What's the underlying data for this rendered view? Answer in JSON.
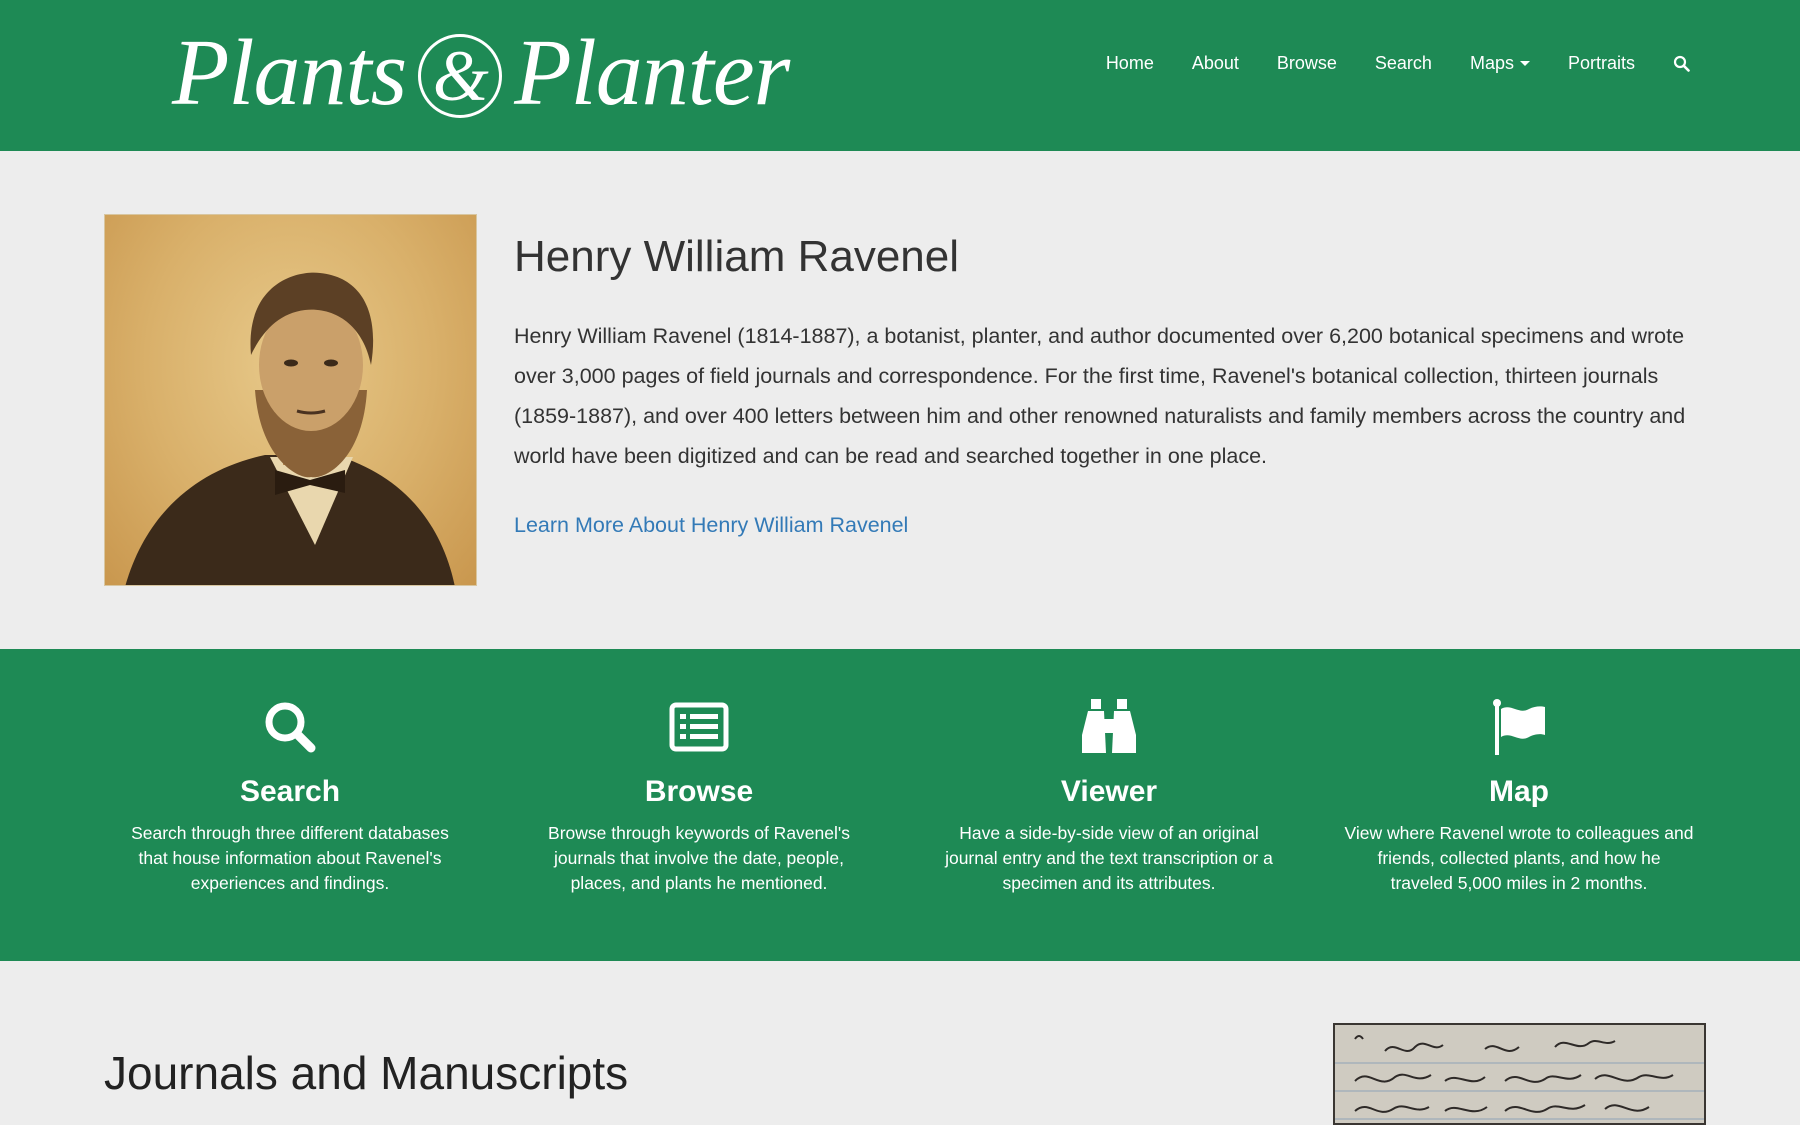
{
  "header": {
    "logo_left": "Plants",
    "logo_amp": "&",
    "logo_right": "Planter",
    "nav": {
      "home": "Home",
      "about": "About",
      "browse": "Browse",
      "search": "Search",
      "maps": "Maps",
      "portraits": "Portraits"
    }
  },
  "intro": {
    "title": "Henry William Ravenel",
    "body": "Henry William Ravenel (1814-1887), a botanist, planter, and author documented over 6,200 botanical specimens and wrote over 3,000 pages of field journals and correspondence. For the first time, Ravenel's botanical collection, thirteen journals (1859-1887), and over 400 letters between him and other renowned naturalists and family members across the country and world have been digitized and can be read and searched together in one place.",
    "link": "Learn More About Henry William Ravenel"
  },
  "features": [
    {
      "icon": "search-icon",
      "title": "Search",
      "desc": "Search through three different databases that house information about Ravenel's experiences and findings."
    },
    {
      "icon": "list-icon",
      "title": "Browse",
      "desc": "Browse through keywords of Ravenel's journals that involve the date, people, places, and plants he mentioned."
    },
    {
      "icon": "binoculars-icon",
      "title": "Viewer",
      "desc": "Have a side-by-side view of an original journal entry and the text transcription or a specimen and its attributes."
    },
    {
      "icon": "flag-icon",
      "title": "Map",
      "desc": "View where Ravenel wrote to colleagues and friends, collected plants, and how he traveled 5,000 miles in 2 months."
    }
  ],
  "journals": {
    "title": "Journals and Manuscripts"
  },
  "colors": {
    "brand_green": "#1e8a55",
    "link_blue": "#337ab7",
    "page_bg": "#ededed"
  }
}
